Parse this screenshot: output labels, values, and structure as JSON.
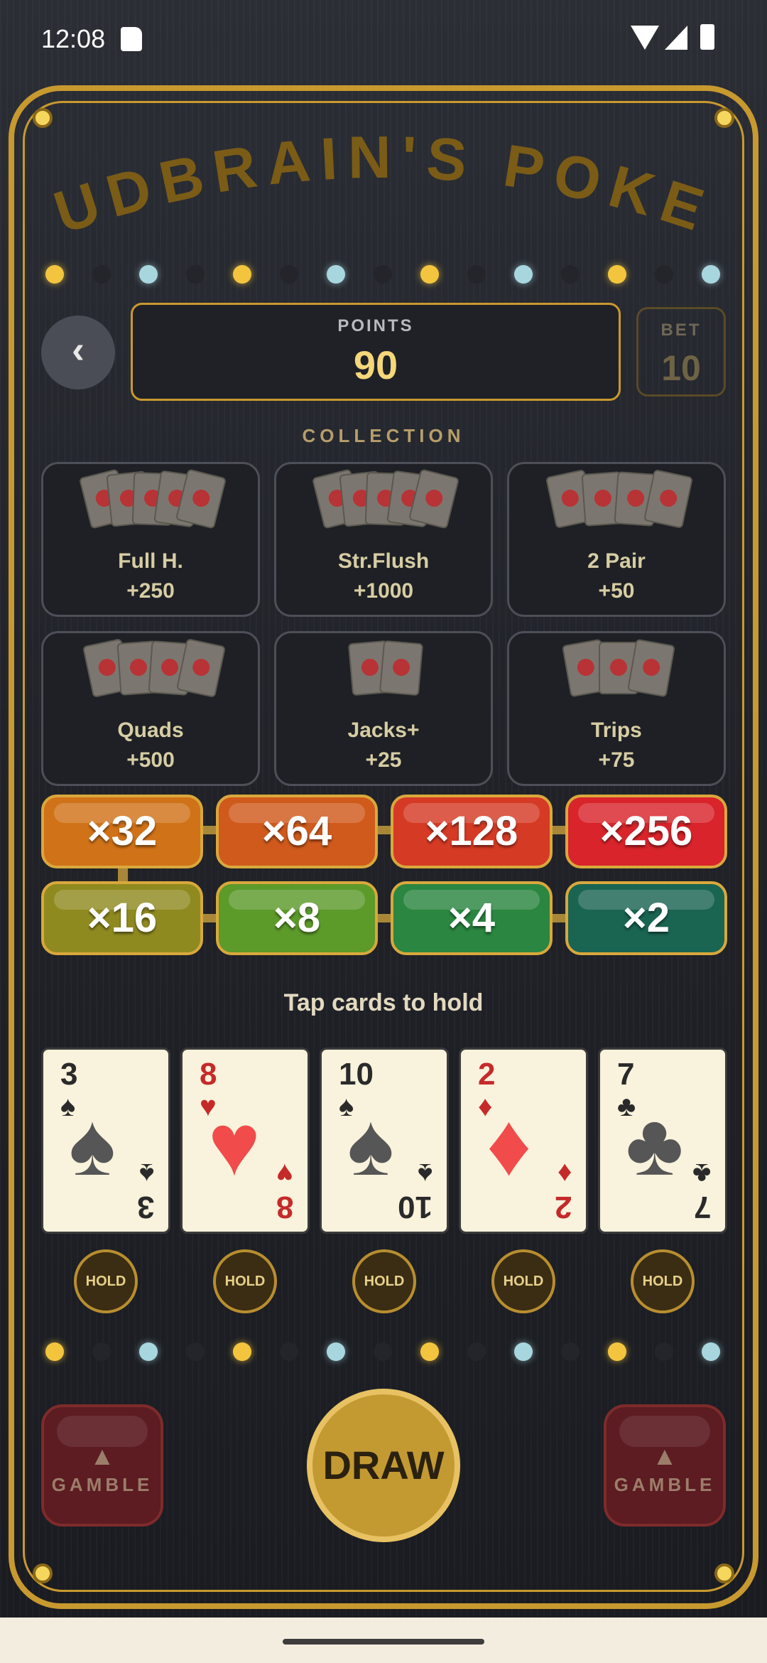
{
  "status_bar": {
    "time": "12:08"
  },
  "game": {
    "title": "BUDBRAIN'S POKER"
  },
  "points": {
    "label": "POINTS",
    "value": "90"
  },
  "bet": {
    "label": "BET",
    "value": "10"
  },
  "back_button": {
    "icon": "chevron-left-icon",
    "label": "‹"
  },
  "collection": {
    "title": "COLLECTION",
    "hands": [
      {
        "name": "Full H.",
        "points": "+250"
      },
      {
        "name": "Str.Flush",
        "points": "+1000"
      },
      {
        "name": "2 Pair",
        "points": "+50"
      },
      {
        "name": "Quads",
        "points": "+500"
      },
      {
        "name": "Jacks+",
        "points": "+25"
      },
      {
        "name": "Trips",
        "points": "+75"
      }
    ]
  },
  "multipliers": {
    "top_row": [
      "×32",
      "×64",
      "×128",
      "×256"
    ],
    "bottom_row": [
      "×16",
      "×8",
      "×4",
      "×2"
    ],
    "colors": {
      "x32": "#d07218",
      "x64": "#d05a1c",
      "x128": "#d53a24",
      "x256": "#d8242a",
      "x16": "#8f8a20",
      "x8": "#5c9a2a",
      "x4": "#2a8640",
      "x2": "#1a6452"
    }
  },
  "hint": "Tap cards to hold",
  "cards": [
    {
      "rank": "3",
      "suit": "♠",
      "color": "black"
    },
    {
      "rank": "8",
      "suit": "♥",
      "color": "red"
    },
    {
      "rank": "10",
      "suit": "♠",
      "color": "black"
    },
    {
      "rank": "2",
      "suit": "♦",
      "color": "red"
    },
    {
      "rank": "7",
      "suit": "♣",
      "color": "black"
    }
  ],
  "hold_label": "HOLD",
  "buttons": {
    "draw": "DRAW",
    "gamble_left": "GAMBLE",
    "gamble_right": "GAMBLE",
    "gamble_icon": "▲"
  },
  "theme": {
    "accent_gold": "#c8992f",
    "light_yellow": "#f3c53e",
    "light_blue": "#a8d6de"
  }
}
